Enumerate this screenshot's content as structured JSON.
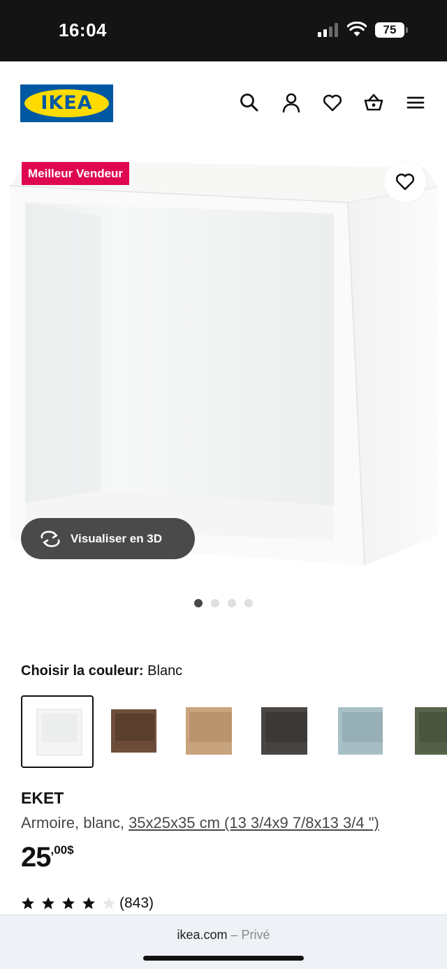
{
  "status_bar": {
    "time": "16:04",
    "battery": "75",
    "signal_icon": "cellular-signal-icon",
    "wifi_icon": "wifi-icon"
  },
  "header": {
    "logo": "IKEA",
    "icons": [
      "search-icon",
      "account-icon",
      "wishlist-heart-icon",
      "shopping-basket-icon",
      "menu-icon"
    ]
  },
  "hero": {
    "badge": "Meilleur Vendeur",
    "badge_color": "#e00751",
    "favorite_icon": "heart-icon",
    "view_3d_label": "Visualiser en 3D",
    "view_3d_icon": "rotate-3d-icon",
    "carousel": {
      "count": 4,
      "active": 1
    }
  },
  "color_selector": {
    "label": "Choisir la couleur:",
    "selected": "Blanc",
    "swatches": [
      {
        "color": "#f5f5f3",
        "selected": true
      },
      {
        "color": "#6f4f3c",
        "selected": false
      },
      {
        "color": "#c9a47c",
        "selected": false
      },
      {
        "color": "#4a4644",
        "selected": false
      },
      {
        "color": "#a9c0c6",
        "selected": false
      },
      {
        "color": "#57634a",
        "selected": false
      }
    ]
  },
  "product": {
    "name": "EKET",
    "desc_prefix": "Armoire, blanc, ",
    "desc_dimensions": "35x25x35 cm (13 3/4x9 7/8x13 3/4 \")",
    "price_integer": "25",
    "price_decimal": ",00$",
    "rating_stars": 4,
    "rating_max": 5,
    "review_count": "(843)"
  },
  "browser": {
    "domain": "ikea.com",
    "mode": "– Privé"
  }
}
